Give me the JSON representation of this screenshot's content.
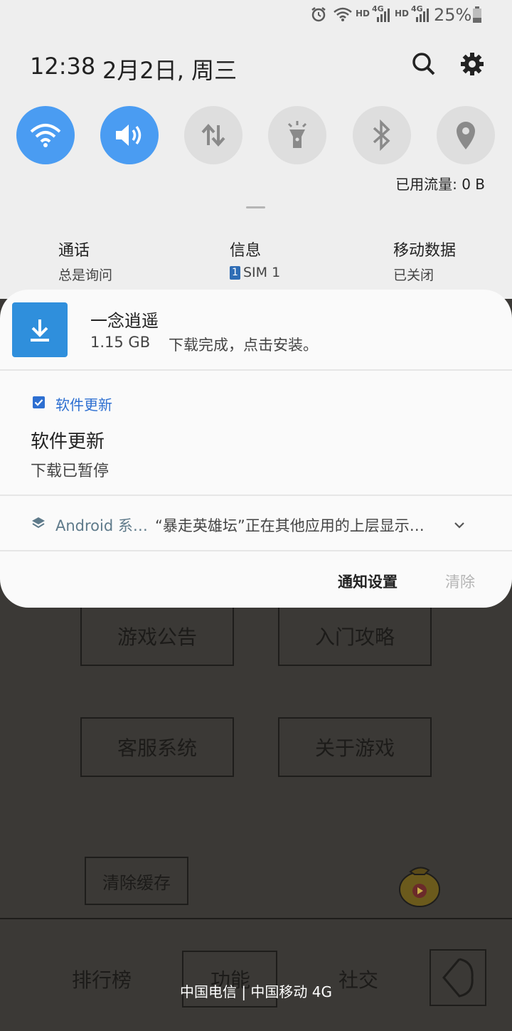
{
  "status_bar": {
    "battery": "25%",
    "hd1": "HD",
    "net1": "4G",
    "hd2": "HD",
    "net2": "4G"
  },
  "header": {
    "time": "12:38",
    "date": "2月2日, 周三"
  },
  "quick_settings": {
    "data_usage": "已用流量: 0 B",
    "tiles": [
      {
        "icon": "wifi-icon",
        "active": true
      },
      {
        "icon": "volume-icon",
        "active": true
      },
      {
        "icon": "mobile-data-icon",
        "active": false
      },
      {
        "icon": "flashlight-icon",
        "active": false
      },
      {
        "icon": "bluetooth-icon",
        "active": false
      },
      {
        "icon": "location-icon",
        "active": false
      }
    ],
    "accent": "#4a9cf2"
  },
  "sim": {
    "call": {
      "title": "通话",
      "value": "总是询问"
    },
    "message": {
      "title": "信息",
      "badge": "1",
      "value": "SIM 1"
    },
    "mobile_data": {
      "title": "移动数据",
      "value": "已关闭"
    }
  },
  "notifications": {
    "download": {
      "title": "一念逍遥",
      "size": "1.15 GB",
      "text": "下载完成，点击安装。"
    },
    "update": {
      "app": "软件更新",
      "title": "软件更新",
      "text": "下载已暂停"
    },
    "android": {
      "app": "Android 系…",
      "text": "“暴走英雄坛”正在其他应用的上层显示…"
    },
    "settings_label": "通知设置",
    "clear_label": "清除"
  },
  "background_app": {
    "buttons": [
      "游戏公告",
      "入门攻略",
      "客服系统",
      "关于游戏",
      "清除缓存"
    ],
    "nav": [
      "排行榜",
      "功能",
      "社交"
    ]
  },
  "carrier": "中国电信 | 中国移动 4G"
}
